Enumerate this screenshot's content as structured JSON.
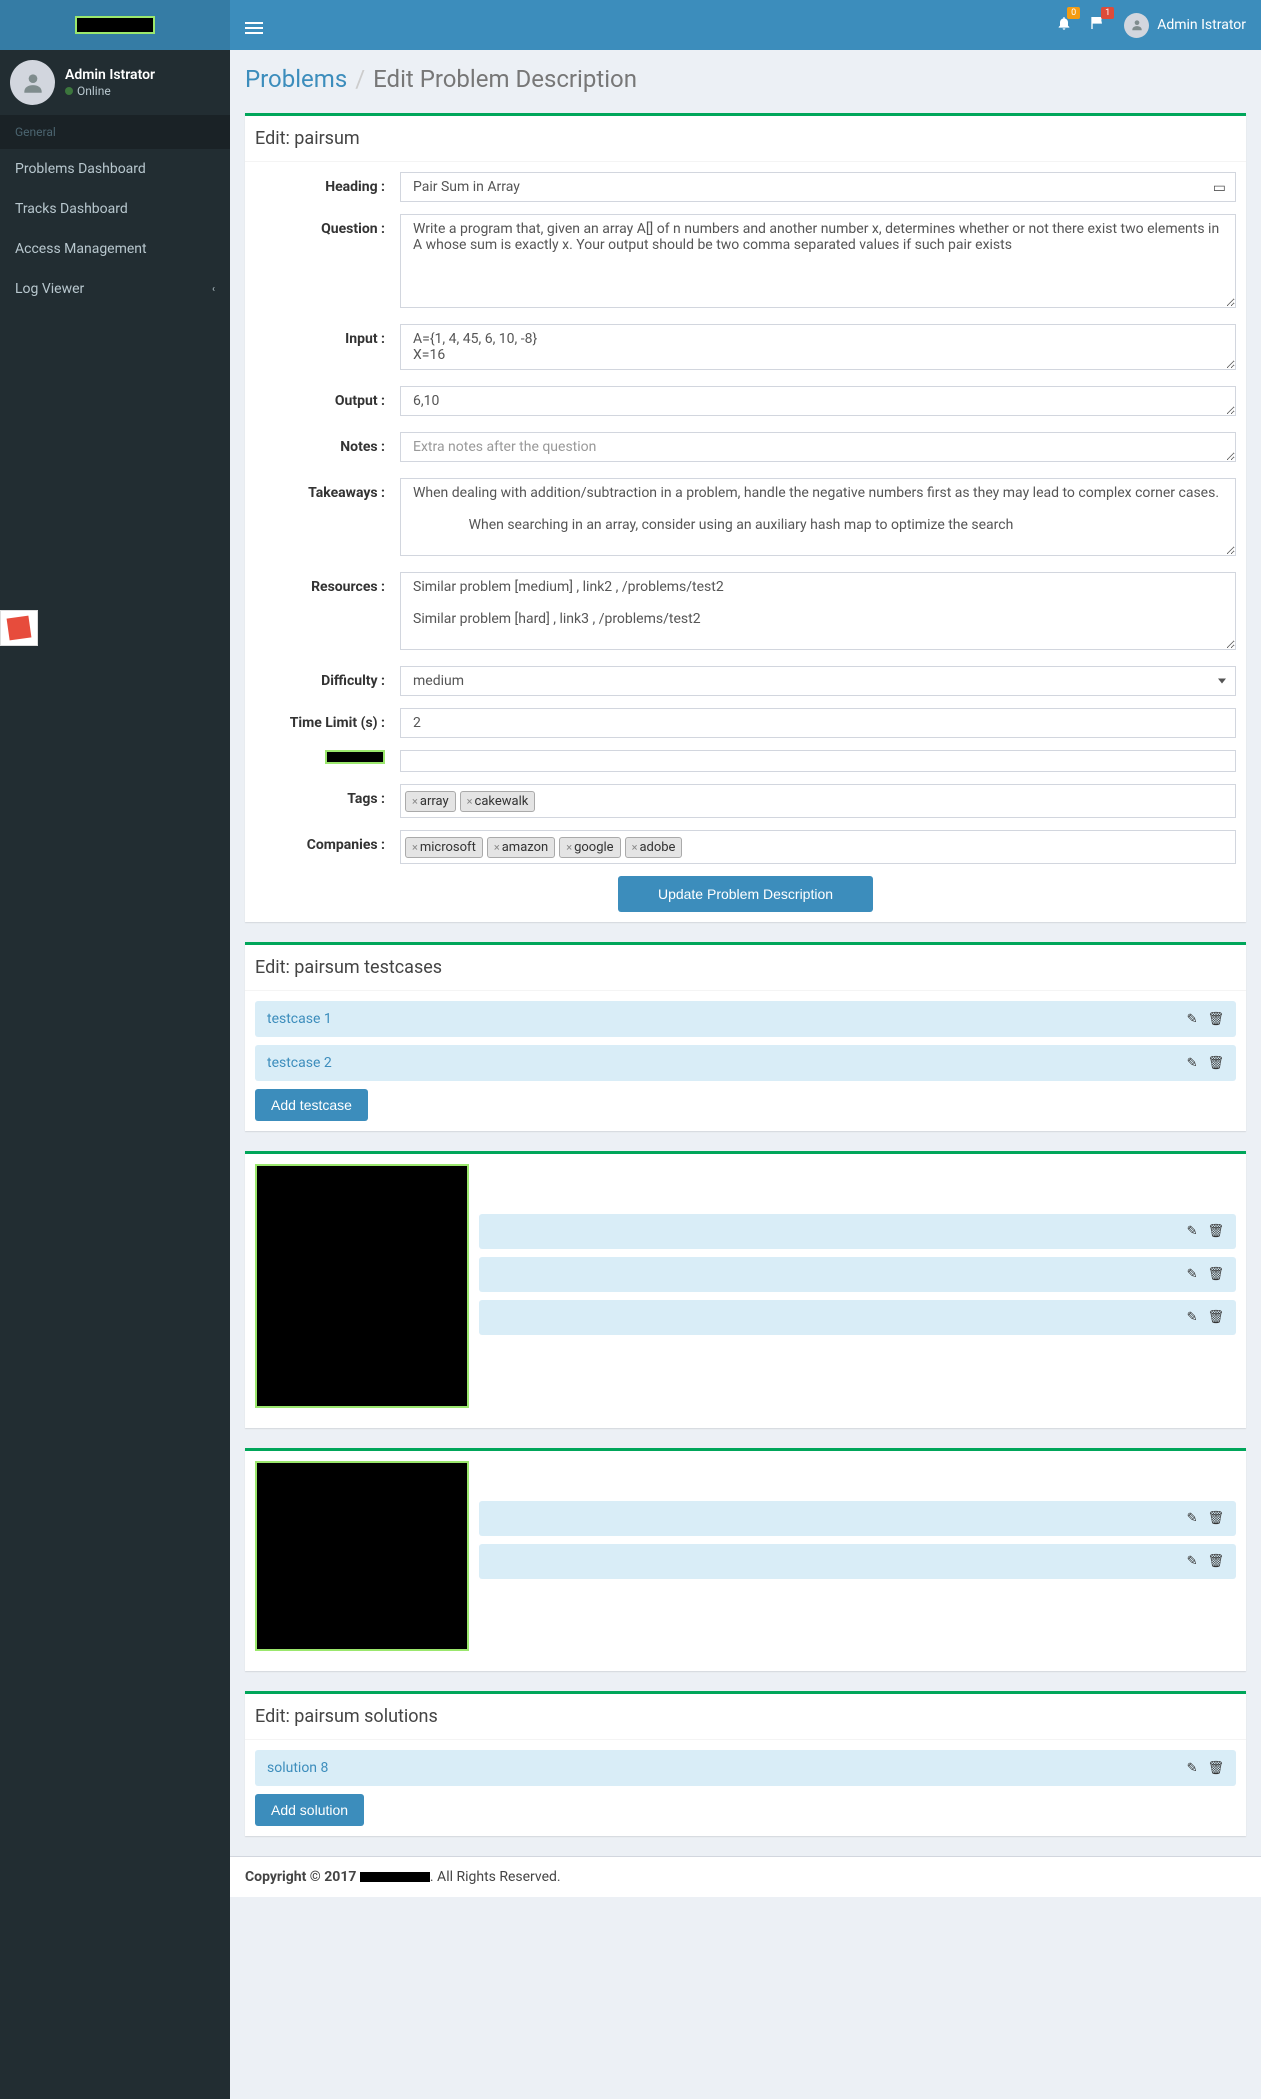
{
  "topbar": {
    "notif_count": "0",
    "msg_count": "1",
    "username": "Admin Istrator"
  },
  "sidebar": {
    "user": {
      "name": "Admin Istrator",
      "status": "Online"
    },
    "section": "General",
    "items": [
      {
        "label": "Problems Dashboard"
      },
      {
        "label": "Tracks Dashboard"
      },
      {
        "label": "Access Management"
      },
      {
        "label": "Log Viewer",
        "chev": true
      }
    ]
  },
  "breadcrumb": {
    "root": "Problems",
    "current": "Edit Problem Description"
  },
  "form": {
    "title": "Edit: pairsum",
    "labels": {
      "heading": "Heading :",
      "question": "Question :",
      "input": "Input :",
      "output": "Output :",
      "notes": "Notes :",
      "takeaways": "Takeaways :",
      "resources": "Resources :",
      "difficulty": "Difficulty :",
      "timelimit": "Time Limit (s) :",
      "tags": "Tags :",
      "companies": "Companies :"
    },
    "heading": "Pair Sum in Array",
    "question": "Write a program that, given an array A[] of n numbers and another number x, determines whether or not there exist two elements in A whose sum is exactly x. Your output should be two comma separated values if such pair exists",
    "input": "A={1, 4, 45, 6, 10, -8}\nX=16",
    "output": "6,10",
    "notes_placeholder": "Extra notes after the question",
    "takeaways": "When dealing with addition/subtraction in a problem, handle the negative numbers first as they may lead to complex corner cases.\n\n                When searching in an array, consider using an auxiliary hash map to optimize the search",
    "resources": "Similar problem [medium] , link2 , /problems/test2\n\nSimilar problem [hard] , link3 , /problems/test2",
    "difficulty": "medium",
    "timelimit": "2",
    "tags": [
      "array",
      "cakewalk"
    ],
    "companies": [
      "microsoft",
      "amazon",
      "google",
      "adobe"
    ],
    "submit": "Update Problem Description"
  },
  "testcases": {
    "title": "Edit: pairsum testcases",
    "items": [
      "testcase 1",
      "testcase 2"
    ],
    "add": "Add testcase"
  },
  "solutions": {
    "title": "Edit: pairsum solutions",
    "items": [
      "solution 8"
    ],
    "add": "Add solution"
  },
  "footer": {
    "copyright": "Copyright © 2017 ",
    "rights": ". All Rights Reserved."
  }
}
